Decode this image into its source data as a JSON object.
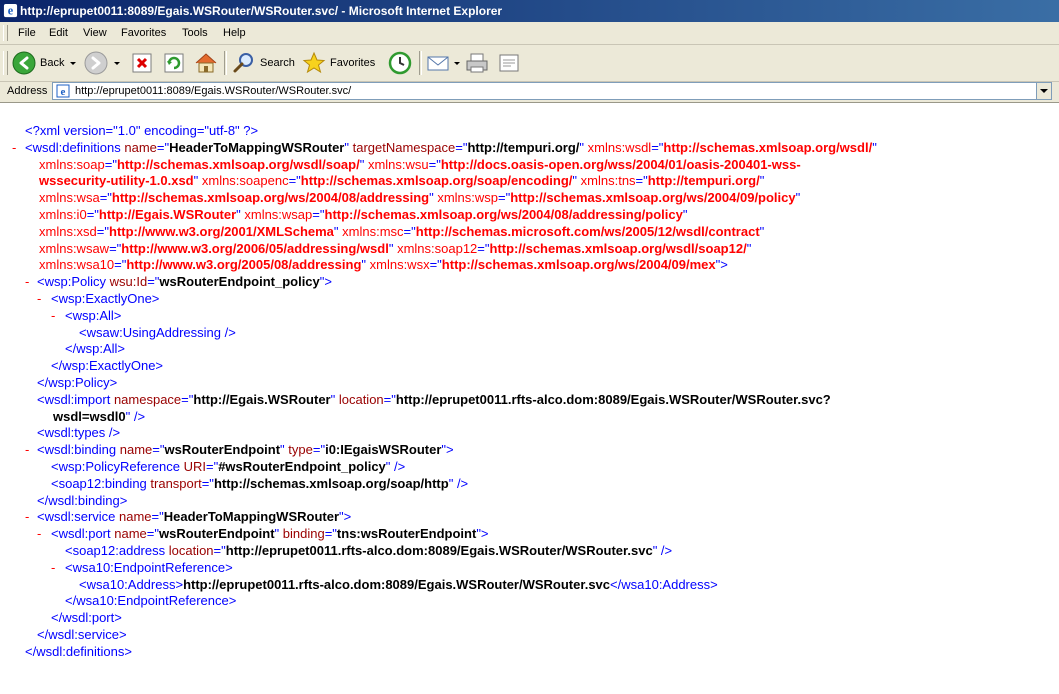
{
  "window": {
    "title": "http://eprupet0011:8089/Egais.WSRouter/WSRouter.svc/ - Microsoft Internet Explorer"
  },
  "menu": [
    "File",
    "Edit",
    "View",
    "Favorites",
    "Tools",
    "Help"
  ],
  "toolbar": {
    "back_label": "Back",
    "search_label": "Search",
    "favorites_label": "Favorites"
  },
  "address": {
    "label": "Address",
    "value": "http://eprupet0011:8089/Egais.WSRouter/WSRouter.svc/"
  },
  "xml": {
    "collapse_glyph": "-",
    "declaration": "<?xml version=\"1.0\" encoding=\"utf-8\" ?>",
    "lines": [
      [
        [
          "t",
          "<"
        ],
        [
          "t",
          "wsdl:definitions"
        ],
        [
          "a",
          " name"
        ],
        [
          "t",
          "=\""
        ],
        [
          "v",
          "HeaderToMappingWSRouter"
        ],
        [
          "t",
          "\""
        ],
        [
          "a",
          " targetNamespace"
        ],
        [
          "t",
          "=\""
        ],
        [
          "v",
          "http://tempuri.org/"
        ],
        [
          "t",
          "\""
        ],
        [
          "n",
          " xmlns:wsdl"
        ],
        [
          "t",
          "=\""
        ],
        [
          "nv",
          "http://schemas.xmlsoap.org/wsdl/"
        ],
        [
          "t",
          "\""
        ]
      ],
      [
        [
          "n",
          "xmlns:soap"
        ],
        [
          "t",
          "=\""
        ],
        [
          "nv",
          "http://schemas.xmlsoap.org/wsdl/soap/"
        ],
        [
          "t",
          "\""
        ],
        [
          "n",
          " xmlns:wsu"
        ],
        [
          "t",
          "=\""
        ],
        [
          "nv",
          "http://docs.oasis-open.org/wss/2004/01/oasis-200401-wss-"
        ]
      ],
      [
        [
          "nv",
          "wssecurity-utility-1.0.xsd"
        ],
        [
          "t",
          "\""
        ],
        [
          "n",
          " xmlns:soapenc"
        ],
        [
          "t",
          "=\""
        ],
        [
          "nv",
          "http://schemas.xmlsoap.org/soap/encoding/"
        ],
        [
          "t",
          "\""
        ],
        [
          "n",
          " xmlns:tns"
        ],
        [
          "t",
          "=\""
        ],
        [
          "nv",
          "http://tempuri.org/"
        ],
        [
          "t",
          "\""
        ]
      ],
      [
        [
          "n",
          "xmlns:wsa"
        ],
        [
          "t",
          "=\""
        ],
        [
          "nv",
          "http://schemas.xmlsoap.org/ws/2004/08/addressing"
        ],
        [
          "t",
          "\""
        ],
        [
          "n",
          " xmlns:wsp"
        ],
        [
          "t",
          "=\""
        ],
        [
          "nv",
          "http://schemas.xmlsoap.org/ws/2004/09/policy"
        ],
        [
          "t",
          "\""
        ]
      ],
      [
        [
          "n",
          "xmlns:i0"
        ],
        [
          "t",
          "=\""
        ],
        [
          "nv",
          "http://Egais.WSRouter"
        ],
        [
          "t",
          "\""
        ],
        [
          "n",
          " xmlns:wsap"
        ],
        [
          "t",
          "=\""
        ],
        [
          "nv",
          "http://schemas.xmlsoap.org/ws/2004/08/addressing/policy"
        ],
        [
          "t",
          "\""
        ]
      ],
      [
        [
          "n",
          "xmlns:xsd"
        ],
        [
          "t",
          "=\""
        ],
        [
          "nv",
          "http://www.w3.org/2001/XMLSchema"
        ],
        [
          "t",
          "\""
        ],
        [
          "n",
          " xmlns:msc"
        ],
        [
          "t",
          "=\""
        ],
        [
          "nv",
          "http://schemas.microsoft.com/ws/2005/12/wsdl/contract"
        ],
        [
          "t",
          "\""
        ]
      ],
      [
        [
          "n",
          "xmlns:wsaw"
        ],
        [
          "t",
          "=\""
        ],
        [
          "nv",
          "http://www.w3.org/2006/05/addressing/wsdl"
        ],
        [
          "t",
          "\""
        ],
        [
          "n",
          " xmlns:soap12"
        ],
        [
          "t",
          "=\""
        ],
        [
          "nv",
          "http://schemas.xmlsoap.org/wsdl/soap12/"
        ],
        [
          "t",
          "\""
        ]
      ],
      [
        [
          "n",
          "xmlns:wsa10"
        ],
        [
          "t",
          "=\""
        ],
        [
          "nv",
          "http://www.w3.org/2005/08/addressing"
        ],
        [
          "t",
          "\""
        ],
        [
          "n",
          " xmlns:wsx"
        ],
        [
          "t",
          "=\""
        ],
        [
          "nv",
          "http://schemas.xmlsoap.org/ws/2004/09/mex"
        ],
        [
          "t",
          "\">"
        ]
      ],
      [
        [
          "t",
          "<"
        ],
        [
          "t",
          "wsp:Policy"
        ],
        [
          "a",
          " wsu:Id"
        ],
        [
          "t",
          "=\""
        ],
        [
          "v",
          "wsRouterEndpoint_policy"
        ],
        [
          "t",
          "\">"
        ]
      ],
      [
        [
          "t",
          "<"
        ],
        [
          "t",
          "wsp:ExactlyOne"
        ],
        [
          "t",
          ">"
        ]
      ],
      [
        [
          "t",
          "<"
        ],
        [
          "t",
          "wsp:All"
        ],
        [
          "t",
          ">"
        ]
      ],
      [
        [
          "t",
          "<"
        ],
        [
          "t",
          "wsaw:UsingAddressing"
        ],
        [
          "t",
          " />"
        ]
      ],
      [
        [
          "t",
          "</"
        ],
        [
          "t",
          "wsp:All"
        ],
        [
          "t",
          ">"
        ]
      ],
      [
        [
          "t",
          "</"
        ],
        [
          "t",
          "wsp:ExactlyOne"
        ],
        [
          "t",
          ">"
        ]
      ],
      [
        [
          "t",
          "</"
        ],
        [
          "t",
          "wsp:Policy"
        ],
        [
          "t",
          ">"
        ]
      ],
      [
        [
          "t",
          "<"
        ],
        [
          "t",
          "wsdl:import"
        ],
        [
          "a",
          " namespace"
        ],
        [
          "t",
          "=\""
        ],
        [
          "v",
          "http://Egais.WSRouter"
        ],
        [
          "t",
          "\""
        ],
        [
          "a",
          " location"
        ],
        [
          "t",
          "=\""
        ],
        [
          "v",
          "http://eprupet0011.rfts-alco.dom:8089/Egais.WSRouter/WSRouter.svc?"
        ]
      ],
      [
        [
          "v",
          "wsdl=wsdl0"
        ],
        [
          "t",
          "\""
        ],
        [
          "t",
          " />"
        ]
      ],
      [
        [
          "t",
          "<"
        ],
        [
          "t",
          "wsdl:types"
        ],
        [
          "t",
          " />"
        ]
      ],
      [
        [
          "t",
          "<"
        ],
        [
          "t",
          "wsdl:binding"
        ],
        [
          "a",
          " name"
        ],
        [
          "t",
          "=\""
        ],
        [
          "v",
          "wsRouterEndpoint"
        ],
        [
          "t",
          "\""
        ],
        [
          "a",
          " type"
        ],
        [
          "t",
          "=\""
        ],
        [
          "v",
          "i0:IEgaisWSRouter"
        ],
        [
          "t",
          "\">"
        ]
      ],
      [
        [
          "t",
          "<"
        ],
        [
          "t",
          "wsp:PolicyReference"
        ],
        [
          "a",
          " URI"
        ],
        [
          "t",
          "=\""
        ],
        [
          "v",
          "#wsRouterEndpoint_policy"
        ],
        [
          "t",
          "\""
        ],
        [
          "t",
          " />"
        ]
      ],
      [
        [
          "t",
          "<"
        ],
        [
          "t",
          "soap12:binding"
        ],
        [
          "a",
          " transport"
        ],
        [
          "t",
          "=\""
        ],
        [
          "v",
          "http://schemas.xmlsoap.org/soap/http"
        ],
        [
          "t",
          "\""
        ],
        [
          "t",
          " />"
        ]
      ],
      [
        [
          "t",
          "</"
        ],
        [
          "t",
          "wsdl:binding"
        ],
        [
          "t",
          ">"
        ]
      ],
      [
        [
          "t",
          "<"
        ],
        [
          "t",
          "wsdl:service"
        ],
        [
          "a",
          " name"
        ],
        [
          "t",
          "=\""
        ],
        [
          "v",
          "HeaderToMappingWSRouter"
        ],
        [
          "t",
          "\">"
        ]
      ],
      [
        [
          "t",
          "<"
        ],
        [
          "t",
          "wsdl:port"
        ],
        [
          "a",
          " name"
        ],
        [
          "t",
          "=\""
        ],
        [
          "v",
          "wsRouterEndpoint"
        ],
        [
          "t",
          "\""
        ],
        [
          "a",
          " binding"
        ],
        [
          "t",
          "=\""
        ],
        [
          "v",
          "tns:wsRouterEndpoint"
        ],
        [
          "t",
          "\">"
        ]
      ],
      [
        [
          "t",
          "<"
        ],
        [
          "t",
          "soap12:address"
        ],
        [
          "a",
          " location"
        ],
        [
          "t",
          "=\""
        ],
        [
          "v",
          "http://eprupet0011.rfts-alco.dom:8089/Egais.WSRouter/WSRouter.svc"
        ],
        [
          "t",
          "\""
        ],
        [
          "t",
          " />"
        ]
      ],
      [
        [
          "t",
          "<"
        ],
        [
          "t",
          "wsa10:EndpointReference"
        ],
        [
          "t",
          ">"
        ]
      ],
      [
        [
          "t",
          "<"
        ],
        [
          "t",
          "wsa10:Address"
        ],
        [
          "t",
          ">"
        ],
        [
          "x",
          "http://eprupet0011.rfts-alco.dom:8089/Egais.WSRouter/WSRouter.svc"
        ],
        [
          "t",
          "</"
        ],
        [
          "t",
          "wsa10:Address"
        ],
        [
          "t",
          ">"
        ]
      ],
      [
        [
          "t",
          "</"
        ],
        [
          "t",
          "wsa10:EndpointReference"
        ],
        [
          "t",
          ">"
        ]
      ],
      [
        [
          "t",
          "</"
        ],
        [
          "t",
          "wsdl:port"
        ],
        [
          "t",
          ">"
        ]
      ],
      [
        [
          "t",
          "</"
        ],
        [
          "t",
          "wsdl:service"
        ],
        [
          "t",
          ">"
        ]
      ],
      [
        [
          "t",
          "</"
        ],
        [
          "t",
          "wsdl:definitions"
        ],
        [
          "t",
          ">"
        ]
      ]
    ]
  }
}
